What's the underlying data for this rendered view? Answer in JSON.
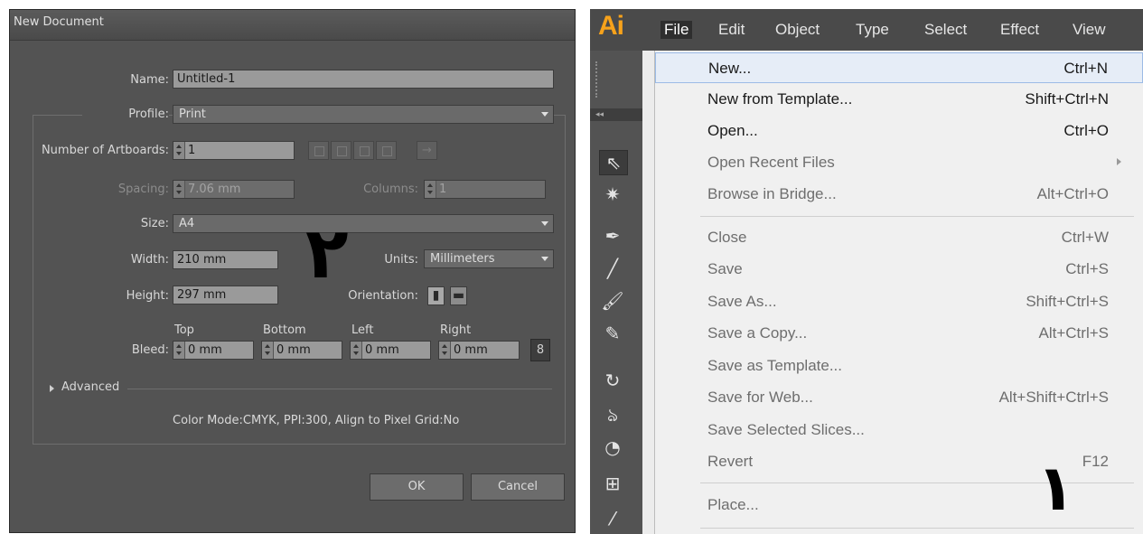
{
  "dialog": {
    "title": "New Document",
    "name_label": "Name:",
    "name_value": "Untitled-1",
    "profile_label": "Profile:",
    "profile_value": "Print",
    "artboards_label": "Number of Artboards:",
    "artboards_value": "1",
    "arrow_glyph": "→",
    "spacing_label": "Spacing:",
    "spacing_value": "7.06 mm",
    "columns_label": "Columns:",
    "columns_value": "1",
    "size_label": "Size:",
    "size_value": "A4",
    "width_label": "Width:",
    "width_value": "210 mm",
    "units_label": "Units:",
    "units_value": "Millimeters",
    "height_label": "Height:",
    "height_value": "297 mm",
    "orientation_label": "Orientation:",
    "bleed_label": "Bleed:",
    "bleed": {
      "top_label": "Top",
      "top_value": "0 mm",
      "bottom_label": "Bottom",
      "bottom_value": "0 mm",
      "left_label": "Left",
      "left_value": "0 mm",
      "right_label": "Right",
      "right_value": "0 mm"
    },
    "advanced_label": "Advanced",
    "summary": "Color Mode:CMYK, PPI:300, Align to Pixel Grid:No",
    "ok_label": "OK",
    "cancel_label": "Cancel"
  },
  "annotations": {
    "dialog_number": "٢",
    "menu_number": "١"
  },
  "app": {
    "logo": "Ai",
    "menubar": [
      "File",
      "Edit",
      "Object",
      "Type",
      "Select",
      "Effect",
      "View"
    ],
    "accent": "#f7a21b"
  },
  "file_menu": [
    {
      "label": "New...",
      "shortcut": "Ctrl+N"
    },
    {
      "label": "New from Template...",
      "shortcut": "Shift+Ctrl+N"
    },
    {
      "label": "Open...",
      "shortcut": "Ctrl+O"
    },
    {
      "label": "Open Recent Files",
      "shortcut": ""
    },
    {
      "label": "Browse in Bridge...",
      "shortcut": "Alt+Ctrl+O"
    },
    {
      "label": "Close",
      "shortcut": "Ctrl+W"
    },
    {
      "label": "Save",
      "shortcut": "Ctrl+S"
    },
    {
      "label": "Save As...",
      "shortcut": "Shift+Ctrl+S"
    },
    {
      "label": "Save a Copy...",
      "shortcut": "Alt+Ctrl+S"
    },
    {
      "label": "Save as Template...",
      "shortcut": ""
    },
    {
      "label": "Save for Web...",
      "shortcut": "Alt+Shift+Ctrl+S"
    },
    {
      "label": "Save Selected Slices...",
      "shortcut": ""
    },
    {
      "label": "Revert",
      "shortcut": "F12"
    },
    {
      "label": "Place...",
      "shortcut": ""
    }
  ]
}
